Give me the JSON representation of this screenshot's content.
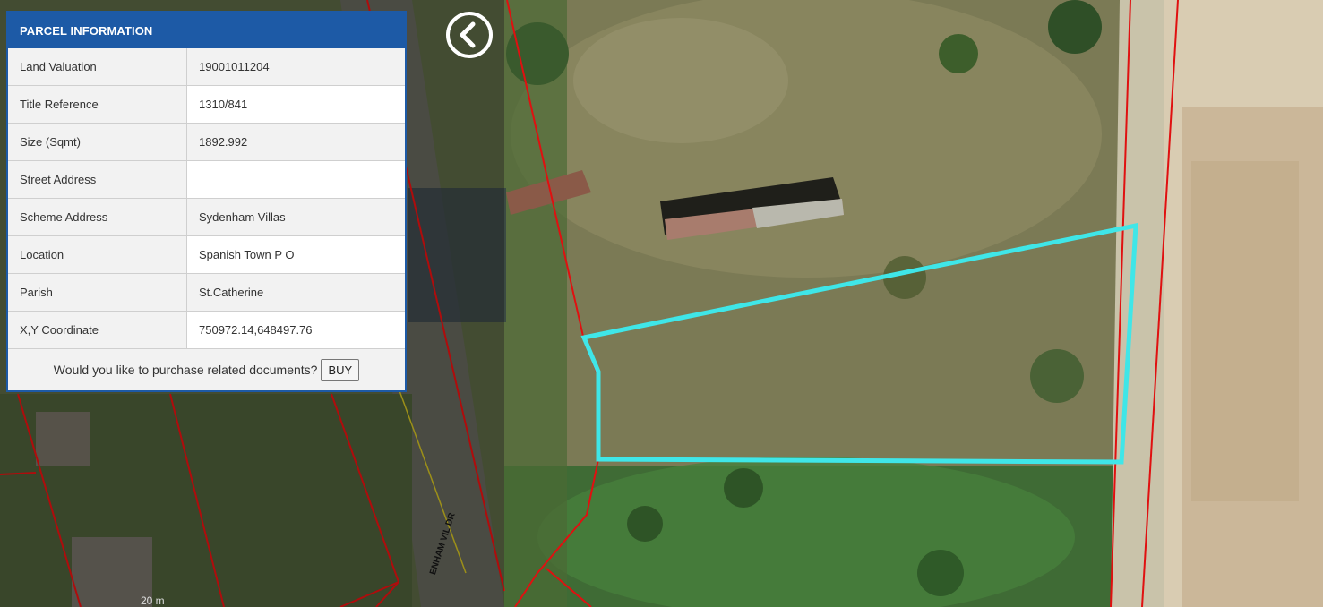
{
  "panel": {
    "title": "PARCEL INFORMATION",
    "rows": [
      {
        "label": "Land Valuation",
        "value": "19001011204"
      },
      {
        "label": "Title Reference",
        "value": "1310/841"
      },
      {
        "label": "Size (Sqmt)",
        "value": "1892.992"
      },
      {
        "label": "Street Address",
        "value": ""
      },
      {
        "label": "Scheme Address",
        "value": "Sydenham Villas"
      },
      {
        "label": "Location",
        "value": "Spanish Town P O"
      },
      {
        "label": "Parish",
        "value": "St.Catherine"
      },
      {
        "label": "X,Y Coordinate",
        "value": "750972.14,648497.76"
      }
    ],
    "purchase_prompt": "Would you like to purchase related documents?",
    "buy_label": "BUY"
  },
  "map": {
    "scale_label": "20 m",
    "street_label": "ENHAM VIL DR",
    "highlight_color": "#3fe6e8",
    "boundary_color": "#e01010",
    "back_icon": "chevron-left-circle-icon"
  }
}
